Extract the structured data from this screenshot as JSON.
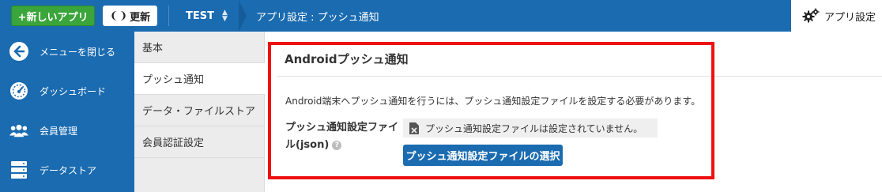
{
  "header": {
    "new_app_label": "+新しいアプリ",
    "refresh_label": "更新",
    "app_name": "TEST",
    "breadcrumb": "アプリ設定 : プッシュ通知",
    "settings_label": "アプリ設定"
  },
  "sidebar": {
    "items": [
      {
        "label": "メニューを閉じる",
        "icon": "arrow-left-circle-icon"
      },
      {
        "label": "ダッシュボード",
        "icon": "speedometer-icon"
      },
      {
        "label": "会員管理",
        "icon": "users-icon"
      },
      {
        "label": "データストア",
        "icon": "database-icon"
      }
    ]
  },
  "subnav": {
    "items": [
      {
        "label": "基本"
      },
      {
        "label": "プッシュ通知",
        "active": true
      },
      {
        "label": "データ・ファイルストア"
      },
      {
        "label": "会員認証設定"
      }
    ]
  },
  "main": {
    "title": "Androidプッシュ通知",
    "description": "Android端末へプッシュ通知を行うには、プッシュ通知設定ファイルを設定する必要があります。",
    "field_label_line1": "プッシュ通知設定ファイ",
    "field_label_line2": "ル(json)",
    "file_status": "プッシュ通知設定ファイルは設定されていません。",
    "select_button": "プッシュ通知設定ファイルの選択"
  },
  "colors": {
    "primary": "#1a6bb0",
    "success": "#3aa53a",
    "highlight": "#ee1111"
  }
}
